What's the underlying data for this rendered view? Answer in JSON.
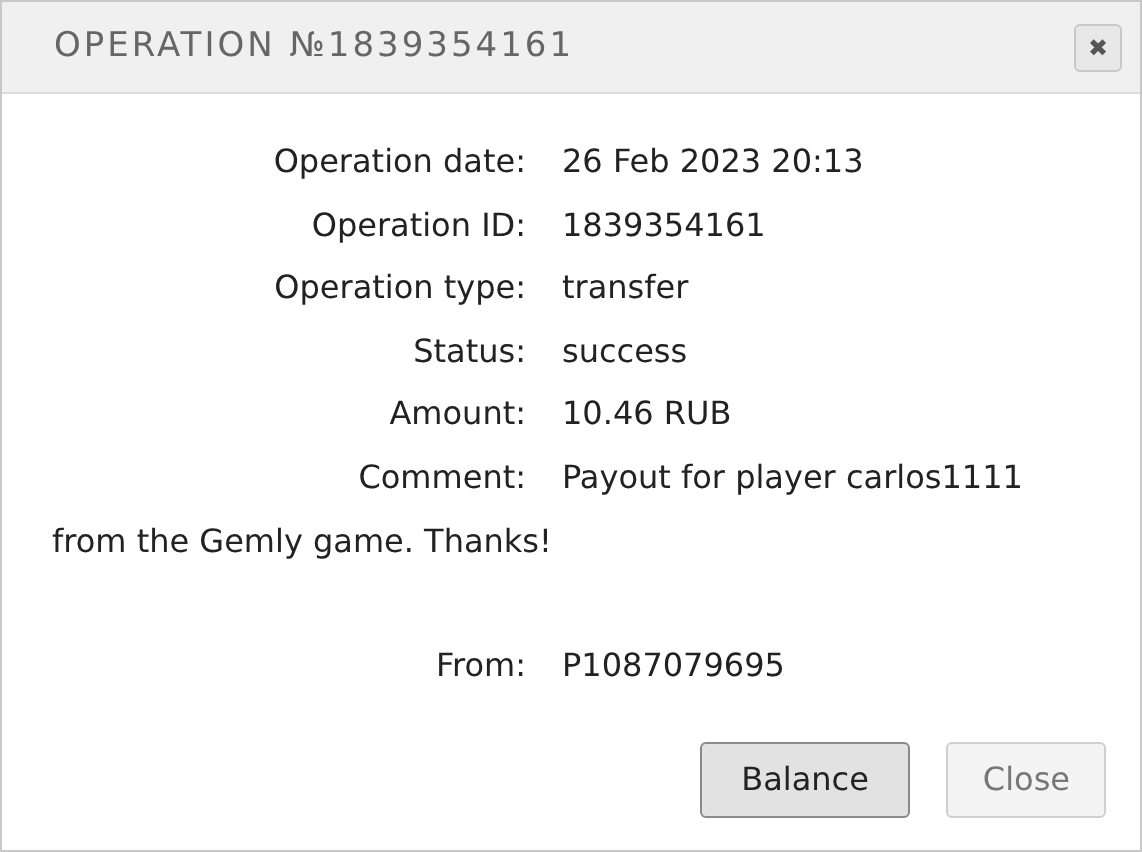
{
  "dialog": {
    "title": "OPERATION №1839354161",
    "close_symbol": "✖"
  },
  "fields": [
    {
      "label": "Operation date:",
      "value": "26 Feb 2023 20:13"
    },
    {
      "label": "Operation ID:",
      "value": "1839354161"
    },
    {
      "label": "Operation type:",
      "value": "transfer"
    },
    {
      "label": "Status:",
      "value": "success"
    },
    {
      "label": "Amount:",
      "value": "10.46 RUB"
    },
    {
      "label": "Comment:",
      "value": "Payout for player carlos1111",
      "continuation": "from the Gemly game. Thanks!"
    },
    {
      "label": "From:",
      "value": "P1087079695"
    }
  ],
  "buttons": [
    {
      "label": "Balance",
      "primary": true
    },
    {
      "label": "Close",
      "primary": false
    }
  ]
}
